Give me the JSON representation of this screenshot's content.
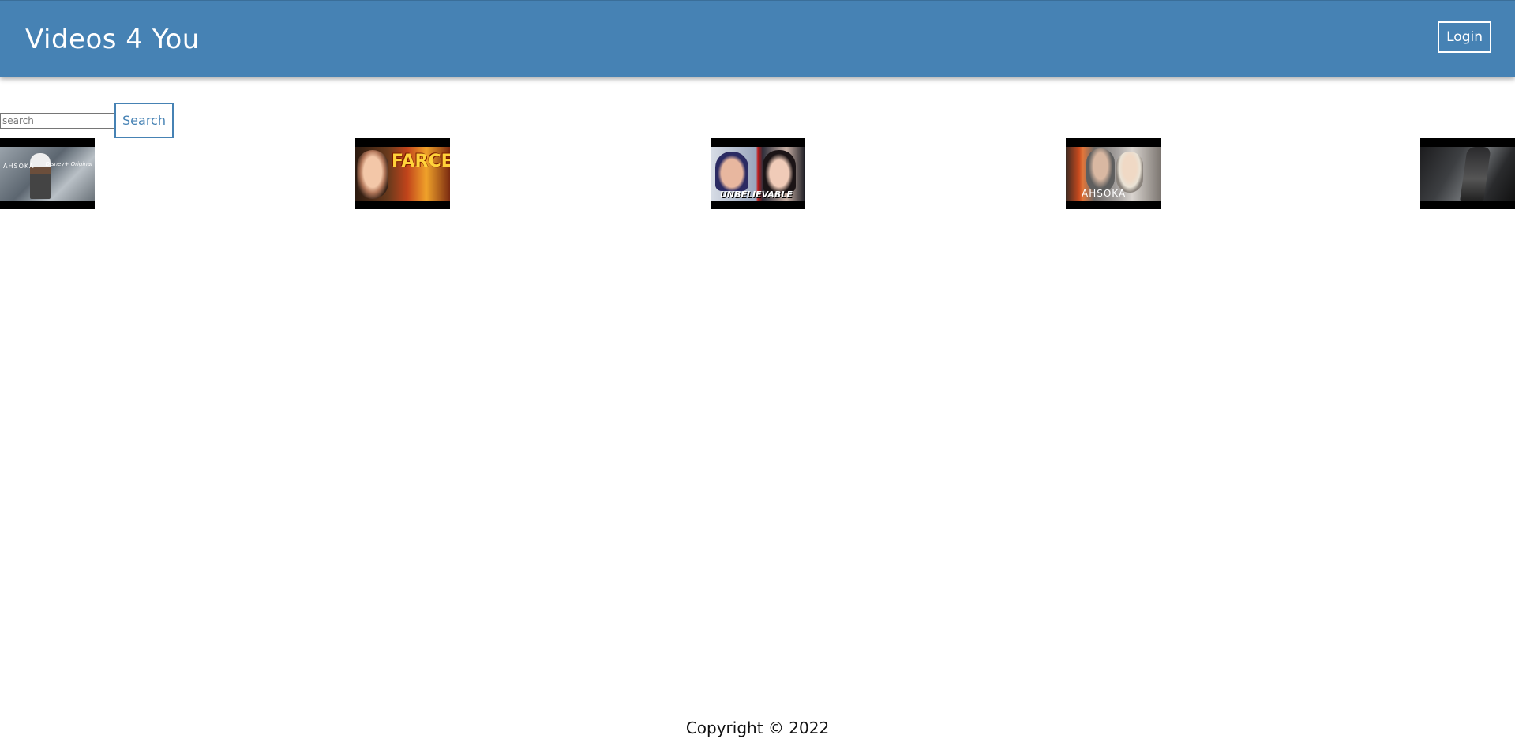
{
  "header": {
    "title": "Videos 4 You",
    "login_label": "Login",
    "background_color": "#4682b4"
  },
  "search": {
    "placeholder": "search",
    "value": "",
    "button_label": "Search"
  },
  "videos": [
    {
      "thumbnail_text": [
        "AHSOKA",
        "Disney+ Original"
      ],
      "icon": "video-thumbnail"
    },
    {
      "thumbnail_text": [
        "FARCE!"
      ],
      "icon": "video-thumbnail"
    },
    {
      "thumbnail_text": [
        "UNBELIEVABLE"
      ],
      "icon": "video-thumbnail"
    },
    {
      "thumbnail_text": [
        "AHSOKA"
      ],
      "icon": "video-thumbnail"
    },
    {
      "thumbnail_text": [],
      "icon": "video-thumbnail"
    }
  ],
  "footer": {
    "copyright": "Copyright © 2022"
  }
}
